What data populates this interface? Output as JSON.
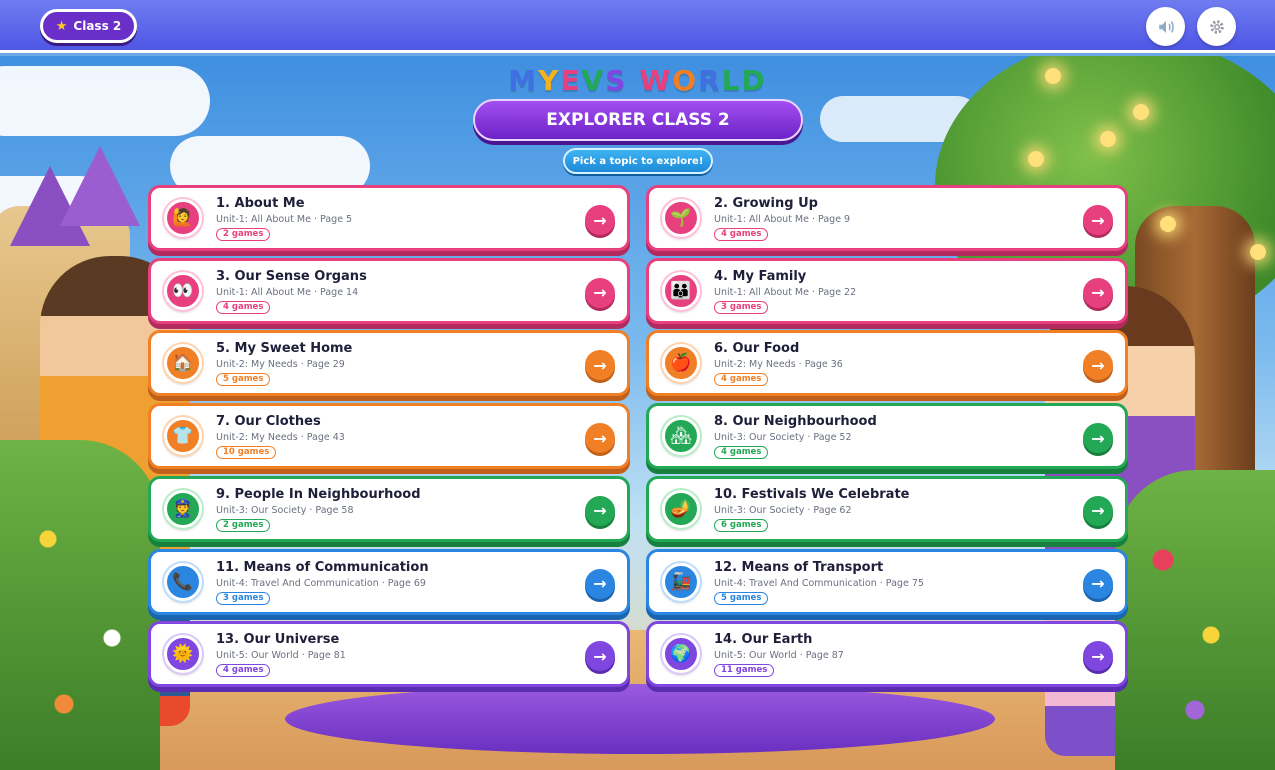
{
  "topbar": {
    "class_label": "Class 2",
    "class_icon": "star-icon",
    "sound_icon": "speaker-icon",
    "settings_icon": "gear-icon"
  },
  "header": {
    "logo_letters": [
      "M",
      "Y",
      "E",
      "V",
      "S",
      " ",
      "W",
      "O",
      "R",
      "L",
      "D"
    ],
    "logo_colors": [
      "#3f6fe0",
      "#f6b21a",
      "#e8407e",
      "#23a855",
      "#8046e0",
      "#000000",
      "#e8407e",
      "#f07f26",
      "#3f6fe0",
      "#23a855",
      "#23a855"
    ],
    "title": "EXPLORER CLASS 2",
    "subtitle": "Pick a topic to explore!"
  },
  "topics": [
    {
      "title": "1. About Me",
      "subtitle": "Unit-1: All About Me · Page 5",
      "games": "2 games",
      "color": "pink",
      "icon": "🙋"
    },
    {
      "title": "2. Growing Up",
      "subtitle": "Unit-1: All About Me · Page 9",
      "games": "4 games",
      "color": "pink",
      "icon": "🌱"
    },
    {
      "title": "3. Our Sense Organs",
      "subtitle": "Unit-1: All About Me · Page 14",
      "games": "4 games",
      "color": "pink",
      "icon": "👀"
    },
    {
      "title": "4. My Family",
      "subtitle": "Unit-1: All About Me · Page 22",
      "games": "3 games",
      "color": "pink",
      "icon": "👪"
    },
    {
      "title": "5. My Sweet Home",
      "subtitle": "Unit-2: My Needs · Page 29",
      "games": "5 games",
      "color": "orange",
      "icon": "🏠"
    },
    {
      "title": "6. Our Food",
      "subtitle": "Unit-2: My Needs · Page 36",
      "games": "4 games",
      "color": "orange",
      "icon": "🍎"
    },
    {
      "title": "7. Our Clothes",
      "subtitle": "Unit-2: My Needs · Page 43",
      "games": "10 games",
      "color": "orange",
      "icon": "👕"
    },
    {
      "title": "8. Our Neighbourhood",
      "subtitle": "Unit-3: Our Society · Page 52",
      "games": "4 games",
      "color": "green",
      "icon": "🏘"
    },
    {
      "title": "9. People In Neighbourhood",
      "subtitle": "Unit-3: Our Society · Page 58",
      "games": "2 games",
      "color": "green",
      "icon": "👮"
    },
    {
      "title": "10. Festivals We Celebrate",
      "subtitle": "Unit-3: Our Society · Page 62",
      "games": "6 games",
      "color": "green",
      "icon": "🪔"
    },
    {
      "title": "11. Means of Communication",
      "subtitle": "Unit-4: Travel And Communication · Page 69",
      "games": "3 games",
      "color": "blue",
      "icon": "📞"
    },
    {
      "title": "12. Means of Transport",
      "subtitle": "Unit-4: Travel And Communication · Page 75",
      "games": "5 games",
      "color": "blue",
      "icon": "🚂"
    },
    {
      "title": "13. Our Universe",
      "subtitle": "Unit-5: Our World · Page 81",
      "games": "4 games",
      "color": "purple",
      "icon": "🌞"
    },
    {
      "title": "14. Our Earth",
      "subtitle": "Unit-5: Our World · Page 87",
      "games": "11 games",
      "color": "purple",
      "icon": "🌍"
    }
  ],
  "arrow_glyph": "→"
}
